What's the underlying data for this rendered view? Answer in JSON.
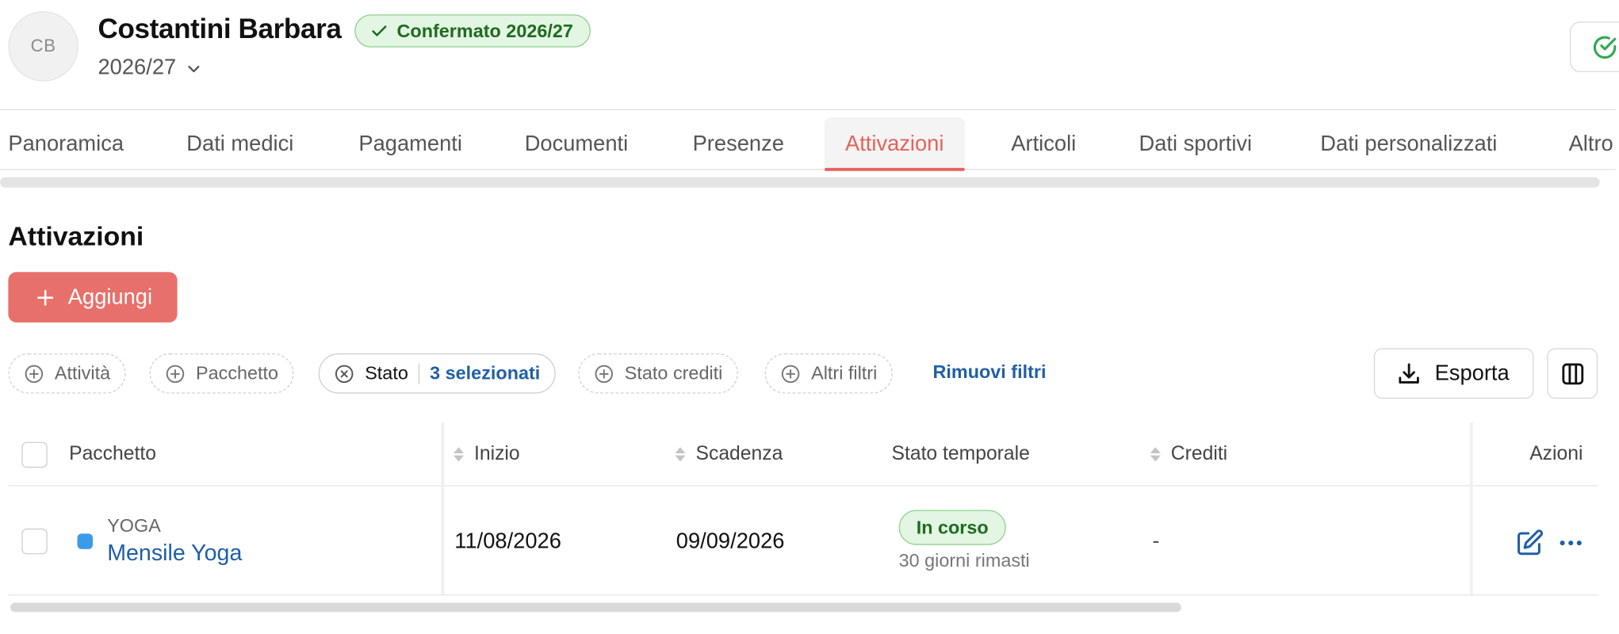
{
  "header": {
    "avatar_initials": "CB",
    "name": "Costantini Barbara",
    "badge": "Confermato 2026/27",
    "season": "2026/27"
  },
  "tabs": [
    {
      "label": "Panoramica"
    },
    {
      "label": "Dati medici"
    },
    {
      "label": "Pagamenti"
    },
    {
      "label": "Documenti"
    },
    {
      "label": "Presenze"
    },
    {
      "label": "Attivazioni",
      "active": true
    },
    {
      "label": "Articoli"
    },
    {
      "label": "Dati sportivi"
    },
    {
      "label": "Dati personalizzati"
    },
    {
      "label": "Altro"
    }
  ],
  "section": {
    "title": "Attivazioni",
    "add_label": "Aggiungi"
  },
  "filters": {
    "attivita": "Attività",
    "pacchetto": "Pacchetto",
    "stato_label": "Stato",
    "stato_value": "3 selezionati",
    "stato_crediti": "Stato crediti",
    "altri_filtri": "Altri filtri",
    "remove": "Rimuovi filtri",
    "export": "Esporta"
  },
  "table": {
    "headers": {
      "pacchetto": "Pacchetto",
      "inizio": "Inizio",
      "scadenza": "Scadenza",
      "stato_temporale": "Stato temporale",
      "crediti": "Crediti",
      "azioni": "Azioni"
    },
    "rows": [
      {
        "category": "YOGA",
        "name": "Mensile Yoga",
        "color": "#3b9be8",
        "inizio": "11/08/2026",
        "scadenza": "09/09/2026",
        "status": "In corso",
        "status_sub": "30 giorni rimasti",
        "crediti": "-"
      }
    ]
  },
  "colors": {
    "accent": "#e4625b",
    "primary_button": "#e8706a",
    "link": "#1f5fa8",
    "success_bg": "#e3f5e3",
    "success_text": "#1f6b1f"
  }
}
